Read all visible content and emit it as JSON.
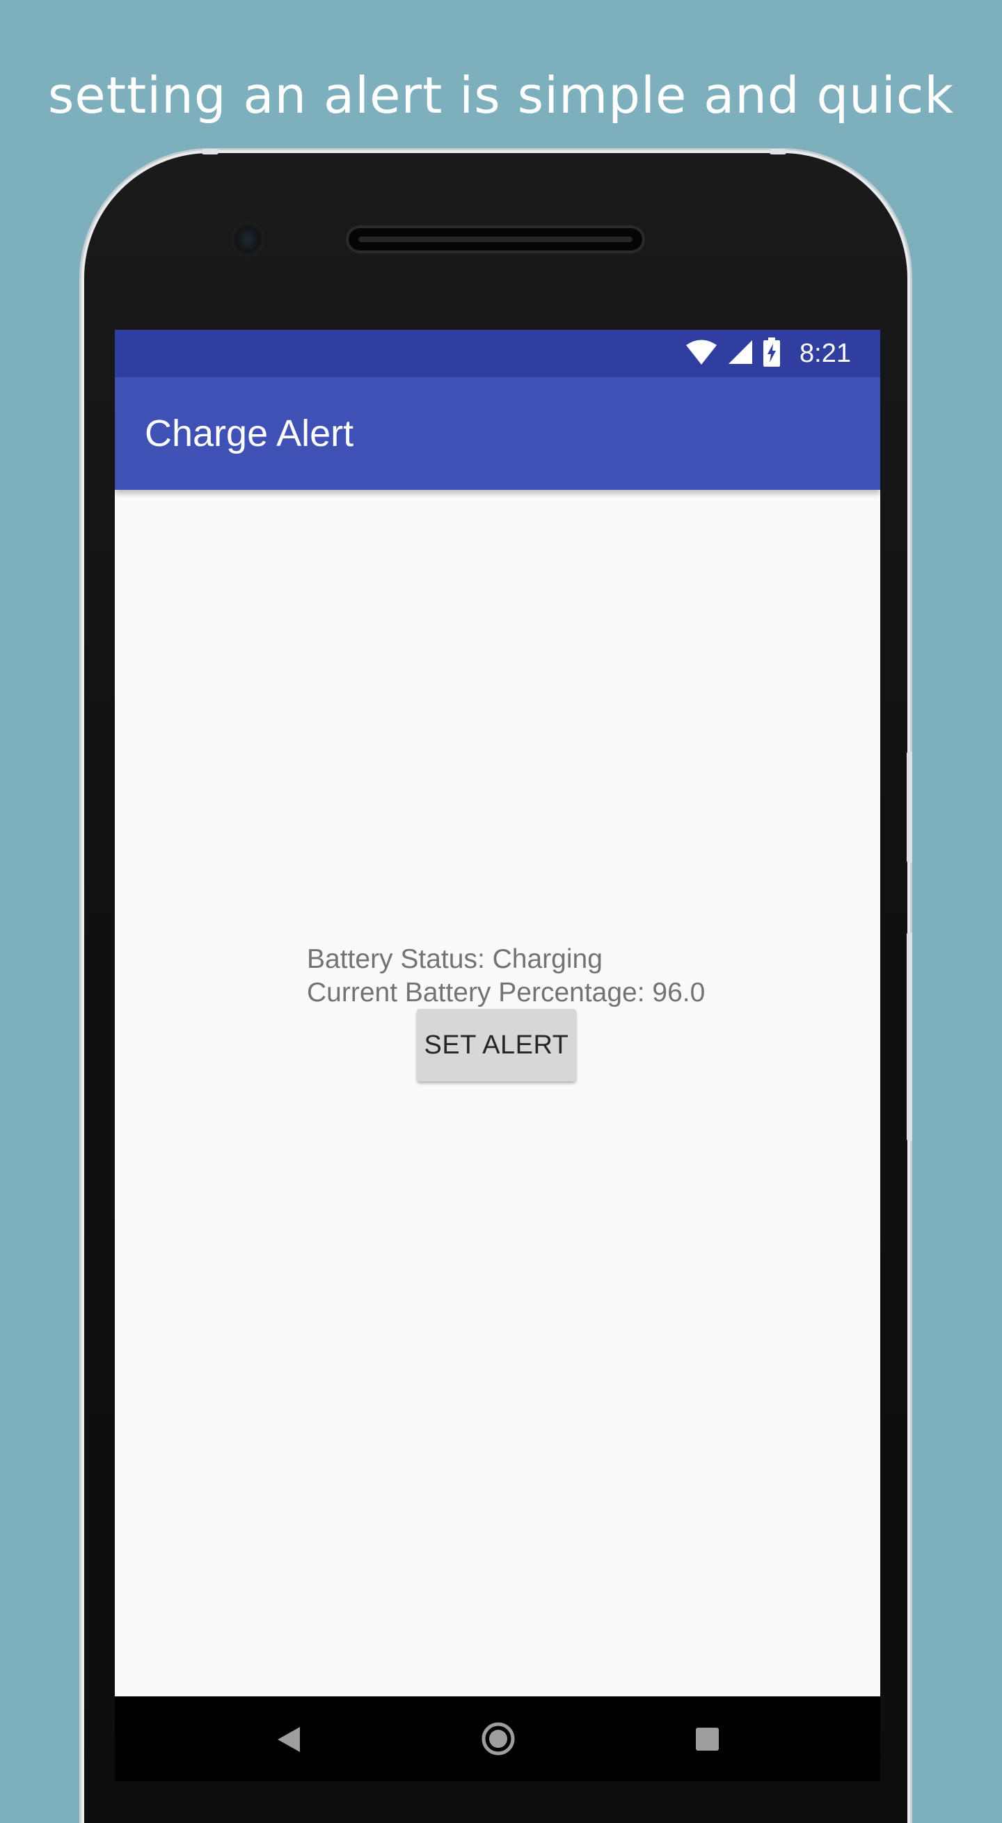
{
  "promo": {
    "caption": "setting an alert is simple and quick"
  },
  "status_bar": {
    "time": "8:21",
    "icons": [
      "wifi-icon",
      "cellular-signal-icon",
      "battery-charging-icon"
    ]
  },
  "app_bar": {
    "title": "Charge Alert"
  },
  "main": {
    "battery_status_line": "Battery Status: Charging",
    "battery_percentage_line": "Current Battery Percentage: 96.0",
    "set_alert_label": "SET ALERT"
  },
  "nav_bar": {
    "buttons": [
      "back-icon",
      "home-icon",
      "recents-icon"
    ]
  },
  "colors": {
    "background": "#7eafbc",
    "status_bar": "#303f9f",
    "app_bar": "#3f51b5",
    "button": "#d6d7d7",
    "text_secondary": "#737373"
  }
}
